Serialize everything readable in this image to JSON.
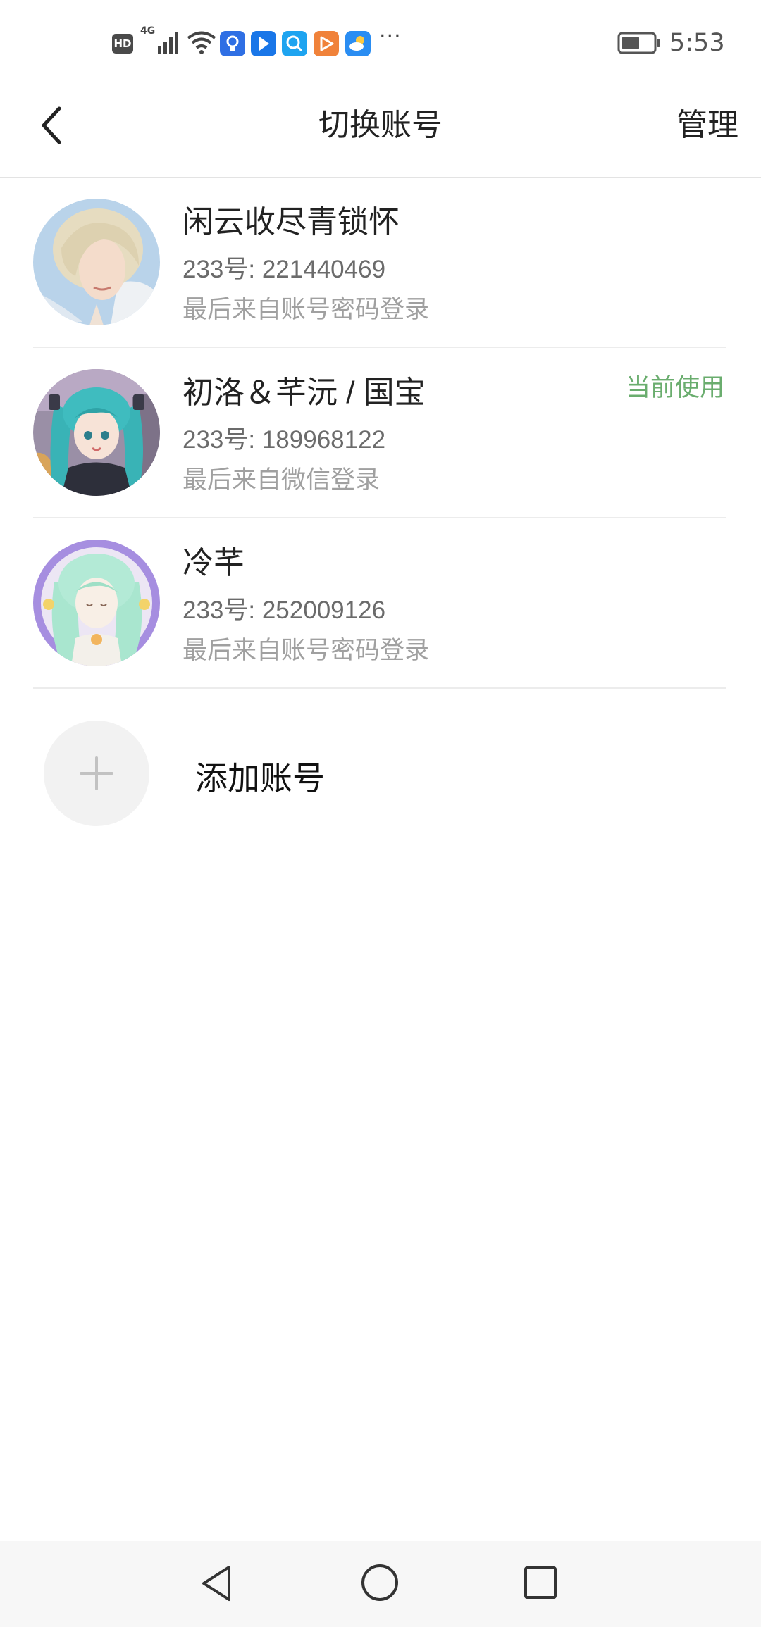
{
  "status_bar": {
    "hd": "HD",
    "network": "4G",
    "more": "···",
    "time": "5:53",
    "icons": [
      "hd-icon",
      "signal-icon",
      "wifi-icon",
      "bulb-app-icon",
      "arrow-app-icon",
      "search-app-icon",
      "play-app-icon",
      "weather-app-icon",
      "battery-icon"
    ]
  },
  "header": {
    "back_icon": "chevron-left-icon",
    "title": "切换账号",
    "manage_label": "管理"
  },
  "accounts": [
    {
      "name": "闲云收尽青锁怀",
      "id_line": "233号: 221440469",
      "login_line": "最后来自账号密码登录"
    },
    {
      "name": "初洛＆芊沅 / 国宝",
      "id_line": "233号: 189968122",
      "login_line": "最后来自微信登录",
      "badge": "当前使用"
    },
    {
      "name": "冷芊",
      "id_line": "233号: 252009126",
      "login_line": "最后来自账号密码登录"
    }
  ],
  "add_account": {
    "icon": "plus-icon",
    "label": "添加账号"
  },
  "nav_bar": {
    "icons": [
      "nav-back-icon",
      "nav-home-icon",
      "nav-recents-icon"
    ]
  },
  "colors": {
    "accent": "#6aad6e",
    "primary_text": "#222222",
    "secondary_text": "#6b6b6b",
    "tertiary_text": "#a0a0a0"
  }
}
